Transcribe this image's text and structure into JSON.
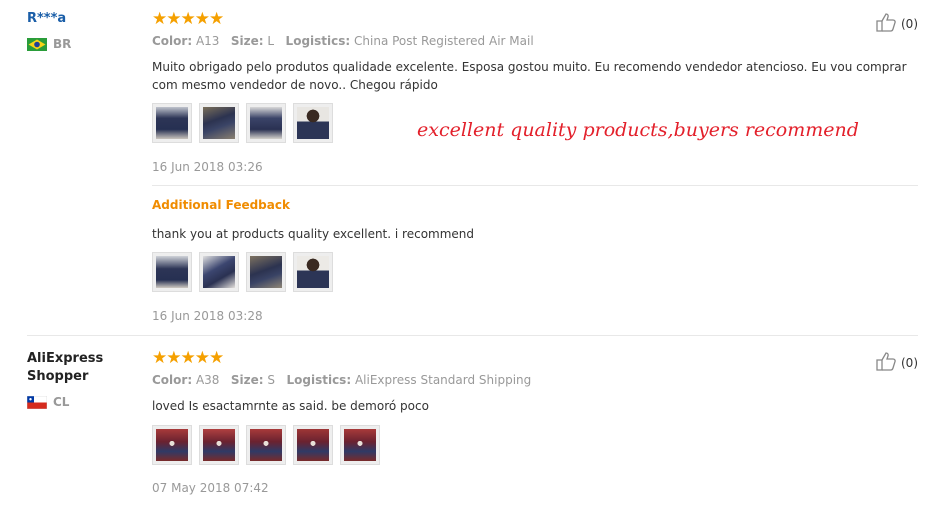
{
  "reviews": [
    {
      "user": "R***a",
      "country": "BR",
      "stars": "★★★★★",
      "color_label": "Color:",
      "color_value": "A13",
      "size_label": "Size:",
      "size_value": "L",
      "logistics_label": "Logistics:",
      "logistics_value": "China Post Registered Air Mail",
      "text_line1": "Muito obrigado pelo produtos qualidade excelente. Esposa gostou muito. Eu recomendo vendedor atencioso. Eu vou comprar",
      "text_line2": "com mesmo vendedor de novo.. Chegou rápido",
      "date": "16 Jun 2018 03:26",
      "likes": "(0)",
      "additional_feedback": {
        "heading": "Additional Feedback",
        "text": "thank you at products quality excellent. i recommend",
        "date": "16 Jun 2018 03:28"
      }
    },
    {
      "user_line1": "AliExpress",
      "user_line2": "Shopper",
      "country": "CL",
      "stars": "★★★★★",
      "color_label": "Color:",
      "color_value": "A38",
      "size_label": "Size:",
      "size_value": "S",
      "logistics_label": "Logistics:",
      "logistics_value": "AliExpress Standard Shipping",
      "text": "loved Is esactamrnte as said. be demoró poco",
      "date": "07 May 2018 07:42",
      "likes": "(0)"
    }
  ],
  "promo_text": "excellent quality products,buyers recommend",
  "colors": {
    "star": "#f5a000",
    "additional_feedback": "#f08c00",
    "promo": "#e3202b",
    "username": "#1a5ea8"
  },
  "icons": {
    "like": "thumbs-up-icon",
    "flag_br": "brazil-flag-icon",
    "flag_cl": "chile-flag-icon"
  }
}
